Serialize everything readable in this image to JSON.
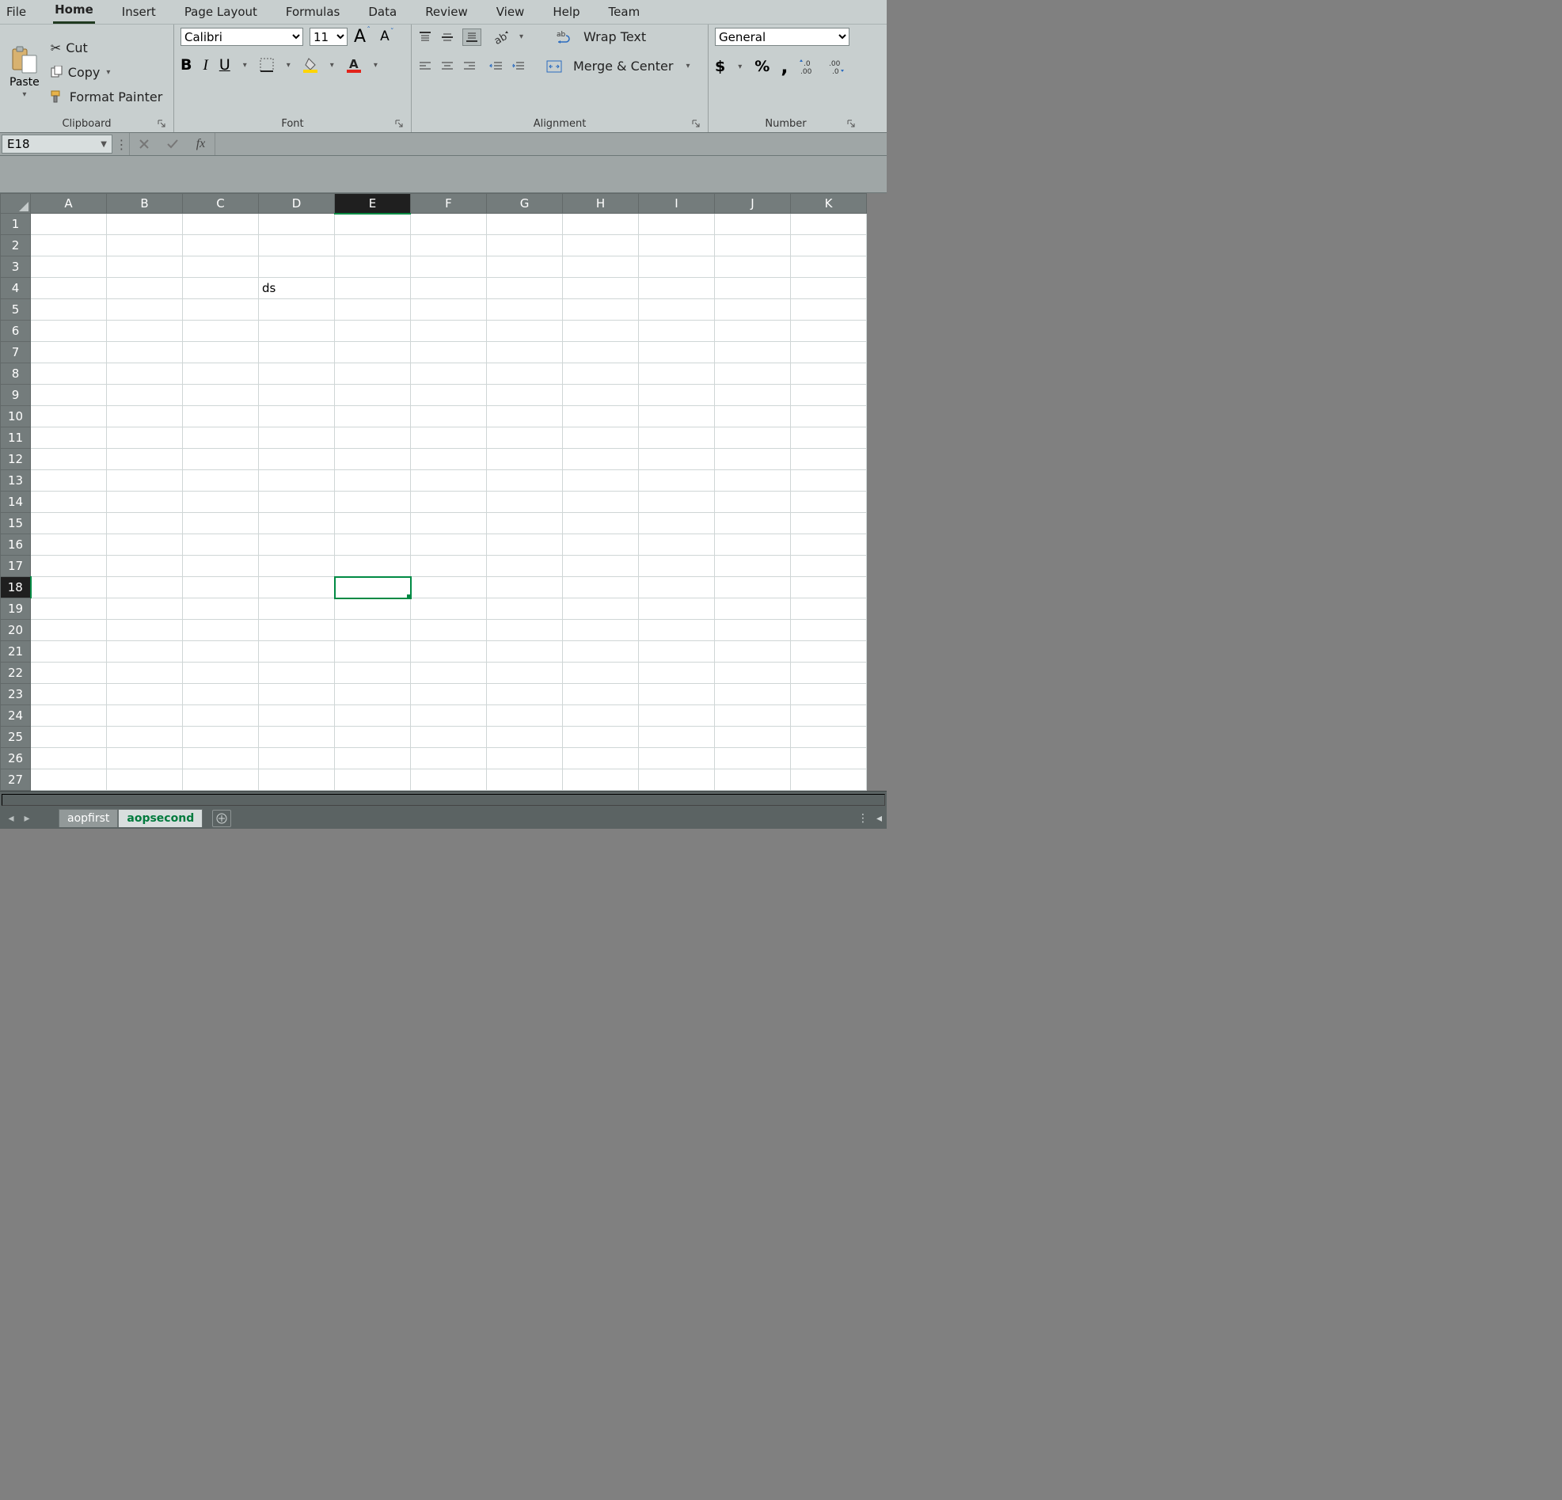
{
  "menu": {
    "tabs": [
      "File",
      "Home",
      "Insert",
      "Page Layout",
      "Formulas",
      "Data",
      "Review",
      "View",
      "Help",
      "Team"
    ],
    "active": "Home"
  },
  "ribbon": {
    "clipboard": {
      "paste": "Paste",
      "cut": "Cut",
      "copy": "Copy",
      "format_painter": "Format Painter",
      "title": "Clipboard"
    },
    "font": {
      "name": "Calibri",
      "size": "11",
      "title": "Font"
    },
    "alignment": {
      "wrap": "Wrap Text",
      "merge": "Merge & Center",
      "title": "Alignment"
    },
    "number": {
      "format": "General",
      "title": "Number"
    }
  },
  "namebox": "E18",
  "formula": "",
  "columns": [
    "A",
    "B",
    "C",
    "D",
    "E",
    "F",
    "G",
    "H",
    "I",
    "J",
    "K"
  ],
  "rows": 27,
  "active_cell": {
    "col": "E",
    "row": 18
  },
  "cell_data": {
    "D4": "ds"
  },
  "sheets": {
    "tabs": [
      "aopfirst",
      "aopsecond"
    ],
    "active": "aopsecond"
  }
}
